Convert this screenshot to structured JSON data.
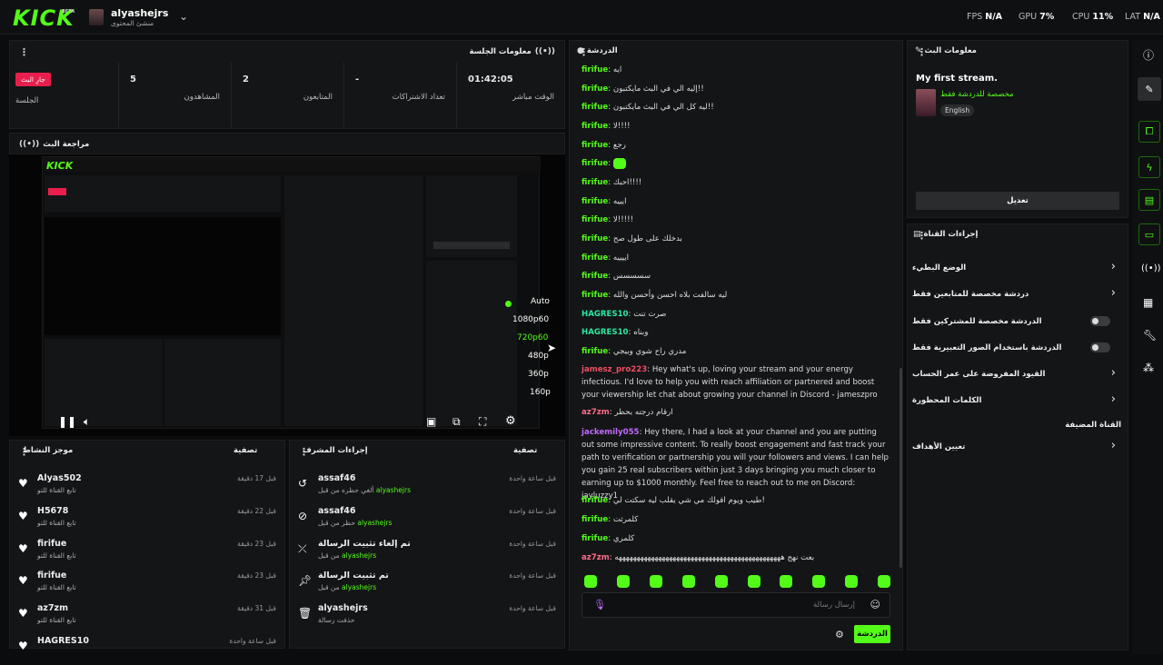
{
  "topbar": {
    "logo": "KICK",
    "beta": "BETA",
    "username": "alyashejrs",
    "role": "منشئ المحتوى",
    "fps_label": "FPS",
    "fps_value": "N/A",
    "gpu_label": "GPU",
    "gpu_value": "7%",
    "cpu_label": "CPU",
    "cpu_value": "11%",
    "lat_label": "LAT",
    "lat_value": "N/A"
  },
  "session": {
    "title": "معلومات الجلسة",
    "live_badge": "جارِ البث",
    "live_label": "الجلسة",
    "viewers_value": "5",
    "viewers_label": "المشاهدون",
    "followers_value": "2",
    "followers_label": "المتابعون",
    "subs_value": "-",
    "subs_label": "تعداد الاشتراكات",
    "time_value": "01:42:05",
    "time_label": "الوقت مباشر"
  },
  "preview": {
    "title": "مراجعة البث",
    "qualities": [
      "Auto",
      "1080p60",
      "720p60",
      "480p",
      "360p",
      "160p"
    ],
    "selected_quality": "720p60"
  },
  "activity": {
    "title": "موجز النشاط",
    "filter": "تصفية",
    "items": [
      {
        "name": "Alyas502",
        "sub": "تابع القناة للتو",
        "time": "قبل 17 دقيقة"
      },
      {
        "name": "H5678",
        "sub": "تابع القناة للتو",
        "time": "قبل 22 دقيقة"
      },
      {
        "name": "firifue",
        "sub": "تابع القناة للتو",
        "time": "قبل 23 دقيقة"
      },
      {
        "name": "firifue",
        "sub": "تابع القناة للتو",
        "time": "قبل 23 دقيقة"
      },
      {
        "name": "az7zm",
        "sub": "تابع القناة للتو",
        "time": "قبل 31 دقيقة"
      },
      {
        "name": "HAGRES10",
        "sub": "",
        "time": "قبل ساعة واحدة"
      }
    ]
  },
  "modactions": {
    "title": "إجراءات المشرف",
    "filter": "تصفية",
    "items": [
      {
        "name": "assaf46",
        "sub": "ألغي حظره من قبل",
        "by": "alyashejrs",
        "time": "قبل ساعة واحدة"
      },
      {
        "name": "assaf46",
        "sub": "حظر من قبل",
        "by": "alyashejrs",
        "time": "قبل ساعة واحدة"
      },
      {
        "name": "تم إلغاء تثبيت الرسالة",
        "sub": "من قبل",
        "by": "alyashejrs",
        "time": "قبل ساعة واحدة"
      },
      {
        "name": "تم تثبيت الرسالة",
        "sub": "من قبل",
        "by": "alyashejrs",
        "time": "قبل ساعة واحدة"
      },
      {
        "name": "alyashejrs",
        "sub": "حذفت رسالة",
        "by": "",
        "time": "قبل ساعة واحدة"
      }
    ]
  },
  "chat": {
    "title": "الدردشة",
    "input_placeholder": "إرسال رسالة",
    "send_label": "الدردشة",
    "messages": [
      {
        "user": "firifue",
        "text": "ايه"
      },
      {
        "user": "firifue",
        "text": "إليه الي في البث مايكتبون!!"
      },
      {
        "user": "firifue",
        "text": "ليه كل الي في البث مايكتبون!!"
      },
      {
        "user": "firifue",
        "text": "لا!!!!"
      },
      {
        "user": "firifue",
        "text": "رجع"
      },
      {
        "user": "firifue",
        "text": ""
      },
      {
        "user": "firifue",
        "text": "احبك!!!!"
      },
      {
        "user": "firifue",
        "text": "ايييه"
      },
      {
        "user": "firifue",
        "text": "لا!!!!!"
      },
      {
        "user": "firifue",
        "text": "بدخلك على طول صح"
      },
      {
        "user": "firifue",
        "text": "اييييه"
      },
      {
        "user": "firifue",
        "text": "سسسسس"
      },
      {
        "user": "firifue",
        "text": "ليه سالفت بلاه احسن وأحسن والله"
      },
      {
        "user": "HAGRES10",
        "text": "صرت تنت"
      },
      {
        "user": "HAGRES10",
        "text": "وبناه"
      },
      {
        "user": "firifue",
        "text": "مدري راح شوي وبيجي"
      },
      {
        "user": "jamesz_pro223",
        "text": "Hey what's up, loving your stream and your energy infectious. I'd love to help you with reach affiliation or partnered and boost your viewership let chat about growing your channel in Discord - jameszpro"
      },
      {
        "user": "az7zm",
        "text": "ارقام درجته بحظر"
      },
      {
        "user": "jackemily055",
        "text": "Hey there, I had a look at your channel and you are putting out some impressive content. To really boost engagement and fast track your path to verification or partnership you will your followers and views. I can help you gain 25 real subscribers within just 3 days bringing you much closer to earning up to $1000 monthly. Feel free to reach out to me on Discord: jayluzzy1"
      },
      {
        "user": "firifue",
        "text": "طيب ويوم اقولك مي شي يقلب ليه سكتت لي!"
      },
      {
        "user": "firifue",
        "text": "كلمرثت"
      },
      {
        "user": "firifue",
        "text": "كلمري"
      },
      {
        "user": "az7zm",
        "text": "بعت نهج ههههههههههههههههههههههههههههههههههههههههههههههه"
      }
    ]
  },
  "stream_info": {
    "title": "معلومات البث",
    "stream_title": "My first stream.",
    "category": "مخصصة للدردشة فقط",
    "language": "English",
    "edit_label": "تعديل"
  },
  "channel_actions": {
    "title": "إجراءات القناة",
    "items": [
      {
        "label": "الوضع البطيء",
        "type": "chevron"
      },
      {
        "label": "دردشة مخصصة للمتابعين فقط",
        "type": "chevron"
      },
      {
        "label": "الدردشة مخصصة للمشتركين فقط",
        "type": "toggle"
      },
      {
        "label": "الدردشة باستخدام الصور التعبيرية فقط",
        "type": "toggle"
      },
      {
        "label": "القيود المفروضة على عمر الحساب",
        "type": "chevron"
      },
      {
        "label": "الكلمات المحظورة",
        "type": "chevron"
      },
      {
        "label": "القناة المضيفة",
        "type": "none"
      },
      {
        "label": "تعيين الأهداف",
        "type": "chevron"
      }
    ]
  },
  "colors": {
    "accent": "#53fc18",
    "bg": "#0b0c0d",
    "panel": "#141517",
    "live": "#e91e4d"
  }
}
